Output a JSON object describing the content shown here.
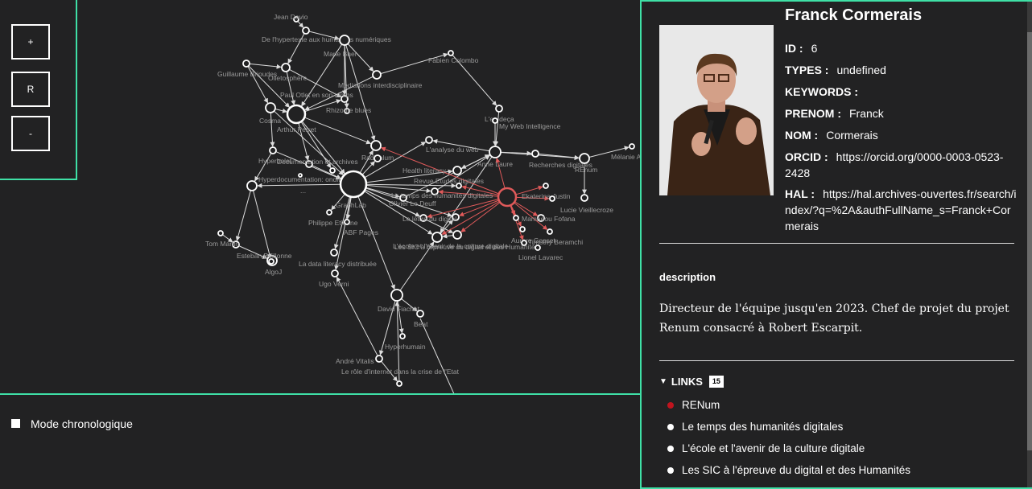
{
  "zoom": {
    "in_label": "+",
    "reset_label": "R",
    "out_label": "-"
  },
  "chrono": {
    "label": "Mode chronologique"
  },
  "graph": {
    "labels": [
      "Jean Davio",
      "De l'hypertexte aux humanités numériques",
      "Guillaume Brioudes",
      "Olletosphère",
      "Marie Bhel",
      "Médiations interdisciplinaire",
      "Fabien Colombo",
      "Paul Otlet en son temps",
      "Rhizome blues",
      "Cosma",
      "Arthur Perret",
      "Hyperbolet",
      "Documentation et archives",
      "L'en deça",
      "My Web Intelligence",
      "Radicalum",
      "L'analyse du web",
      "Health literacy",
      "Anne Laure",
      "Recherches digitales",
      "REnum",
      "Mélanie A",
      "Revue Etudes digitales",
      "Hyperdocumentation: ondit",
      "GraphLab",
      "Olivier Le Deuff",
      "Le temps des humanités digitales",
      "Ekaterina Justin",
      "Franck Cormerais",
      "Lucie Vieillecroze",
      "Le lettre du digital",
      "Mamadou Fofana",
      "L'école et l'avenir de la culture digitale",
      "Philippe Etienne",
      "ABF Pages",
      "Aurore Gosset",
      "Timothy Beramchi",
      "Tom Martin",
      "Esteban Beillonne",
      "Les SIC à l'épreuve du digital et des Humanités",
      "Lionel Lavarec",
      "AlgoJ",
      "La data literacy distribuée",
      "Ugo Verni",
      "David Fiachet",
      "Beat",
      "Hyperhumain",
      "André Vitalis",
      "Le rôle d'internet dans la crise de l'Etat",
      "..."
    ]
  },
  "person": {
    "name": "Franck Cormerais",
    "id_label": "ID :",
    "id_value": "6",
    "types_label": "TYPES :",
    "types_value": "undefined",
    "keywords_label": "KEYWORDS :",
    "prenom_label": "PRENOM :",
    "prenom_value": "Franck",
    "nom_label": "NOM :",
    "nom_value": "Cormerais",
    "orcid_label": "ORCID :",
    "orcid_value": "https://orcid.org/0000-0003-0523-2428",
    "hal_label": "HAL :",
    "hal_value": "https://hal.archives-ouvertes.fr/search/index/?q=%2A&authFullName_s=Franck+Cormerais",
    "description_title": "description",
    "description": "Directeur de l'équipe jusqu'en 2023. Chef de projet du projet Renum consacré à Robert Escarpit.",
    "links_title": "LINKS",
    "links_count": "15",
    "links": [
      "RENum",
      "Le temps des humanités digitales",
      "L'école et l'avenir de la culture digitale",
      "Les SIC à l'épreuve du digital et des Humanités"
    ],
    "link_colors": [
      "#c0141e",
      "#ffffff",
      "#ffffff",
      "#ffffff"
    ]
  },
  "colors": {
    "accent": "#3fe0a6",
    "selected_node": "#e05a5a",
    "background": "#222223"
  }
}
